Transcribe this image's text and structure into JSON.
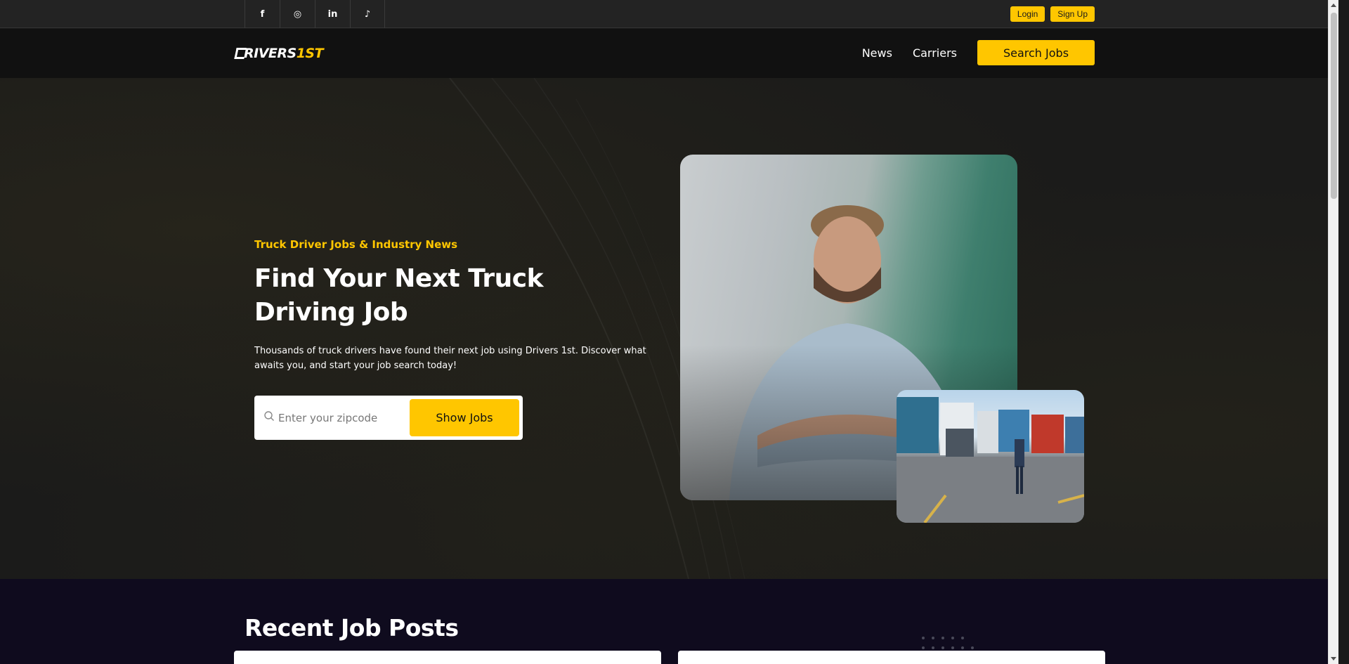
{
  "topbar": {
    "socials": [
      {
        "icon": "facebook-icon",
        "glyph": "f"
      },
      {
        "icon": "instagram-icon",
        "glyph": "◎"
      },
      {
        "icon": "linkedin-icon",
        "glyph": "in"
      },
      {
        "icon": "tiktok-icon",
        "glyph": "♪"
      }
    ],
    "login_label": "Login",
    "signup_label": "Sign Up"
  },
  "navbar": {
    "logo_main": "RIVERS",
    "logo_accent": "1ST",
    "links": [
      "News",
      "Carriers"
    ],
    "cta_label": "Search Jobs"
  },
  "hero": {
    "eyebrow": "Truck Driver Jobs & Industry News",
    "headline": "Find Your Next Truck Driving Job",
    "description": "Thousands of truck drivers have found their next job using Drivers 1st. Discover what awaits you, and start your job search today!",
    "zip_placeholder": "Enter your zipcode",
    "show_jobs_label": "Show Jobs"
  },
  "jobs": {
    "title": "Recent Job Posts"
  },
  "colors": {
    "accent": "#ffc600",
    "nav_bg": "#111111",
    "hero_bg": "#1b1b1a",
    "jobs_bg": "#0f0b1e"
  }
}
